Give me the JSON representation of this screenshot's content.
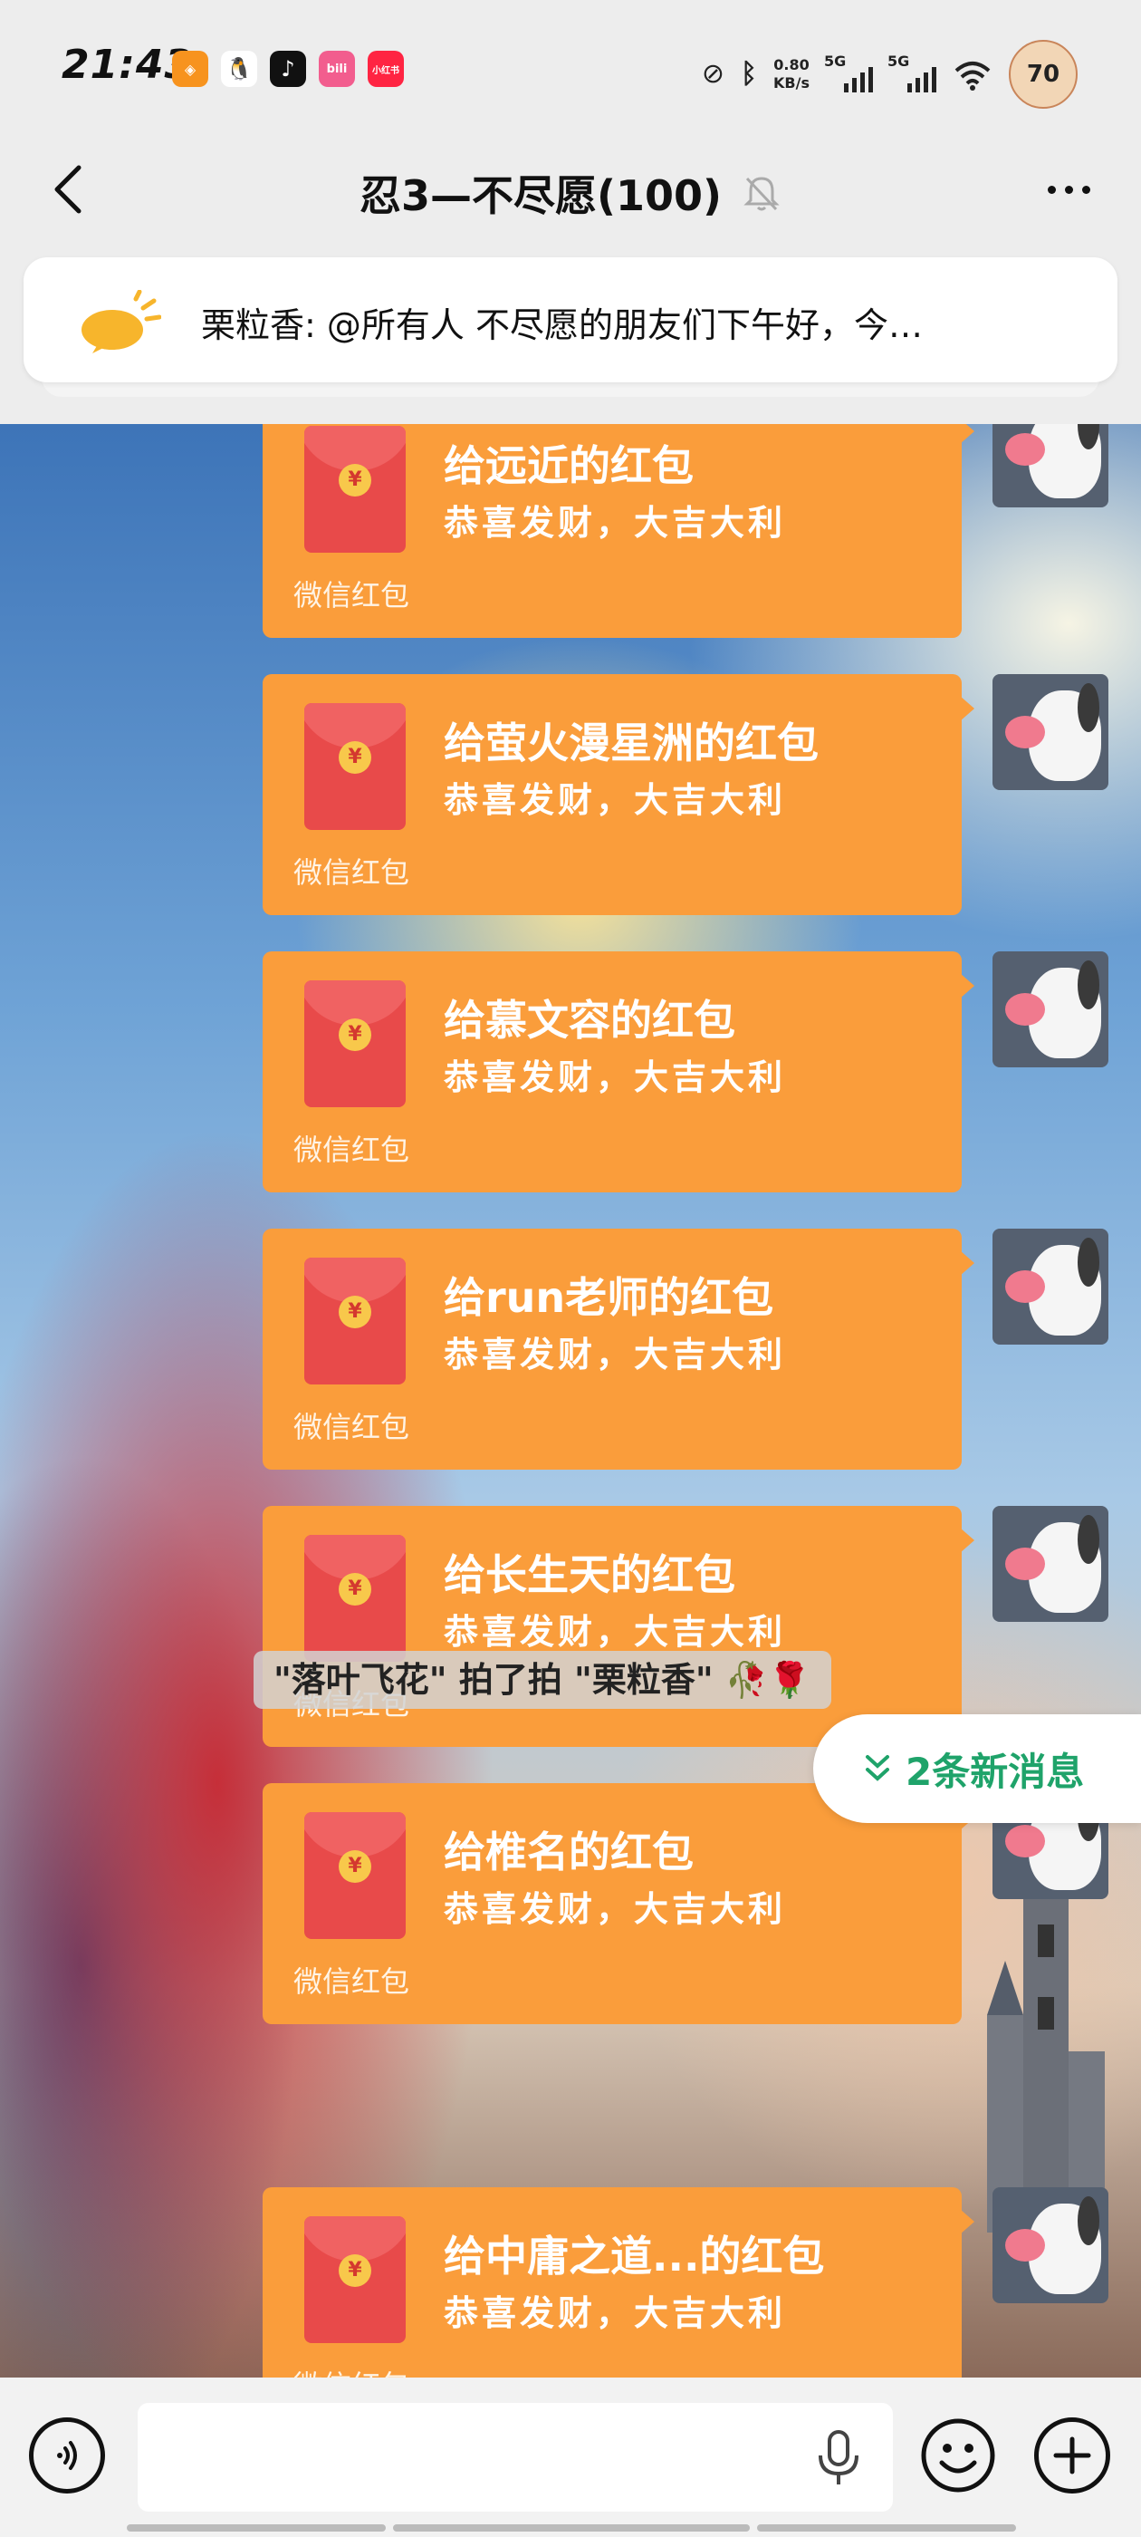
{
  "status_bar": {
    "time": "21:43",
    "net_speed": "0.80",
    "net_unit": "KB/s",
    "signal_1": "5G",
    "signal_2": "5G",
    "avatar_text": "70",
    "app_icons": [
      {
        "name": "orange-app-icon",
        "color": "#f7931e",
        "glyph": "◈"
      },
      {
        "name": "qq-icon",
        "color": "#ffffff",
        "glyph": "🐧"
      },
      {
        "name": "tiktok-icon",
        "color": "#111111",
        "glyph": "♪"
      },
      {
        "name": "bilibili-icon",
        "color": "#f25d8e",
        "glyph": "bili"
      },
      {
        "name": "xiaohongshu-icon",
        "color": "#ff2442",
        "glyph": "小红书"
      }
    ]
  },
  "nav": {
    "title": "忍3—不尽愿(100)"
  },
  "announcement": {
    "text": "栗粒香: @所有人  不尽愿的朋友们下午好，今…"
  },
  "red_packets": [
    {
      "title": "给远近的红包",
      "subtitle": "恭喜发财，大吉大利",
      "footer": "微信红包"
    },
    {
      "title": "给萤火漫星洲的红包",
      "subtitle": "恭喜发财，大吉大利",
      "footer": "微信红包"
    },
    {
      "title": "给慕文容的红包",
      "subtitle": "恭喜发财，大吉大利",
      "footer": "微信红包"
    },
    {
      "title": "给run老师的红包",
      "subtitle": "恭喜发财，大吉大利",
      "footer": "微信红包"
    },
    {
      "title": "给长生天的红包",
      "subtitle": "恭喜发财，大吉大利",
      "footer": "微信红包"
    },
    {
      "title": "给椎名的红包",
      "subtitle": "恭喜发财，大吉大利",
      "footer": "微信红包"
    },
    {
      "title": "给中庸之道...的红包",
      "subtitle": "恭喜发财，大吉大利",
      "footer": "微信红包"
    }
  ],
  "system_message": "\"落叶飞花\" 拍了拍 \"栗粒香\" 🥀🌹",
  "new_messages": "2条新消息",
  "input": {
    "placeholder": ""
  },
  "colors": {
    "red_packet_bg": "#fa9d3b",
    "new_message_text": "#1fa36a"
  }
}
